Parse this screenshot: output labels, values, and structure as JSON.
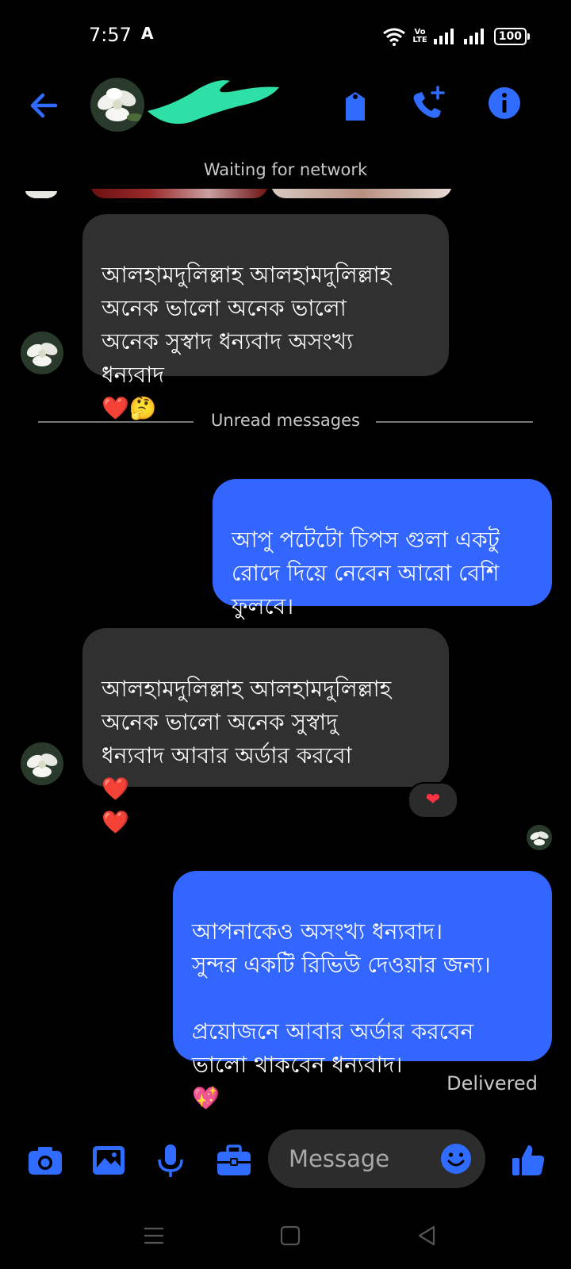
{
  "status_bar": {
    "time": "7:57",
    "notif_glyph": "A",
    "volte": "Vo\nLTE",
    "battery": "100"
  },
  "header": {
    "network_status": "Waiting for network"
  },
  "messages": [
    {
      "dir": "in",
      "text": "আলহামদুলিল্লাহ আলহামদুলিল্লাহ\nঅনেক ভালো অনেক ভালো\nঅনেক সুস্বাদ  ধন্যবাদ অসংখ্য\nধন্যবাদ",
      "emoji": "❤️🤔"
    },
    {
      "dir": "out",
      "text": "আপু পটেটো চিপস গুলা একটু\nরোদে দিয়ে নেবেন আরো বেশি\nফুলবে।"
    },
    {
      "dir": "in",
      "text": "আলহামদুলিল্লাহ আলহামদুলিল্লাহ\nঅনেক ভালো  অনেক সুস্বাদু\nধন্যবাদ আবার অর্ডার করবো",
      "emoji": "❤️\n❤️"
    },
    {
      "dir": "out",
      "text": "আপনাকেও অসংখ্য ধন্যবাদ।\nসুন্দর একটি রিভিউ দেওয়ার জন্য।\n\nপ্রয়োজনে আবার অর্ডার করবেন\nভালো থাকবেন ধন্যবাদ।",
      "emoji": "💖"
    }
  ],
  "divider_label": "Unread messages",
  "reaction": "❤",
  "delivered_label": "Delivered",
  "composer": {
    "placeholder": "Message"
  },
  "colors": {
    "accent": "#3366ff",
    "incoming_bubble": "#303030",
    "icon_blue": "#2f6cff"
  },
  "icons": [
    "back-arrow-icon",
    "tag-icon",
    "add-call-icon",
    "info-icon",
    "camera-icon",
    "image-icon",
    "microphone-icon",
    "briefcase-icon",
    "emoji-icon",
    "thumbs-up-icon",
    "menu-nav-icon",
    "home-nav-icon",
    "back-nav-icon"
  ]
}
